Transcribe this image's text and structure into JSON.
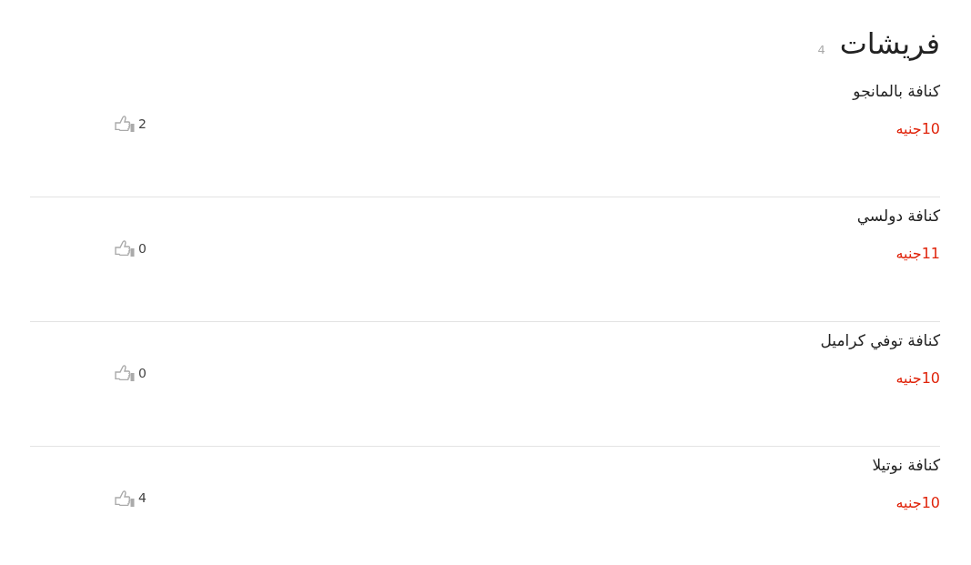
{
  "section": {
    "title": "فريشات",
    "count": "4"
  },
  "items": [
    {
      "name": "كنافة بالمانجو",
      "price": "10جنيه",
      "likes": "2"
    },
    {
      "name": "كنافة دولسي",
      "price": "11جنيه",
      "likes": "0"
    },
    {
      "name": "كنافة توفي كراميل",
      "price": "10جنيه",
      "likes": "0"
    },
    {
      "name": "كنافة نوتيلا",
      "price": "10جنيه",
      "likes": "4"
    }
  ]
}
